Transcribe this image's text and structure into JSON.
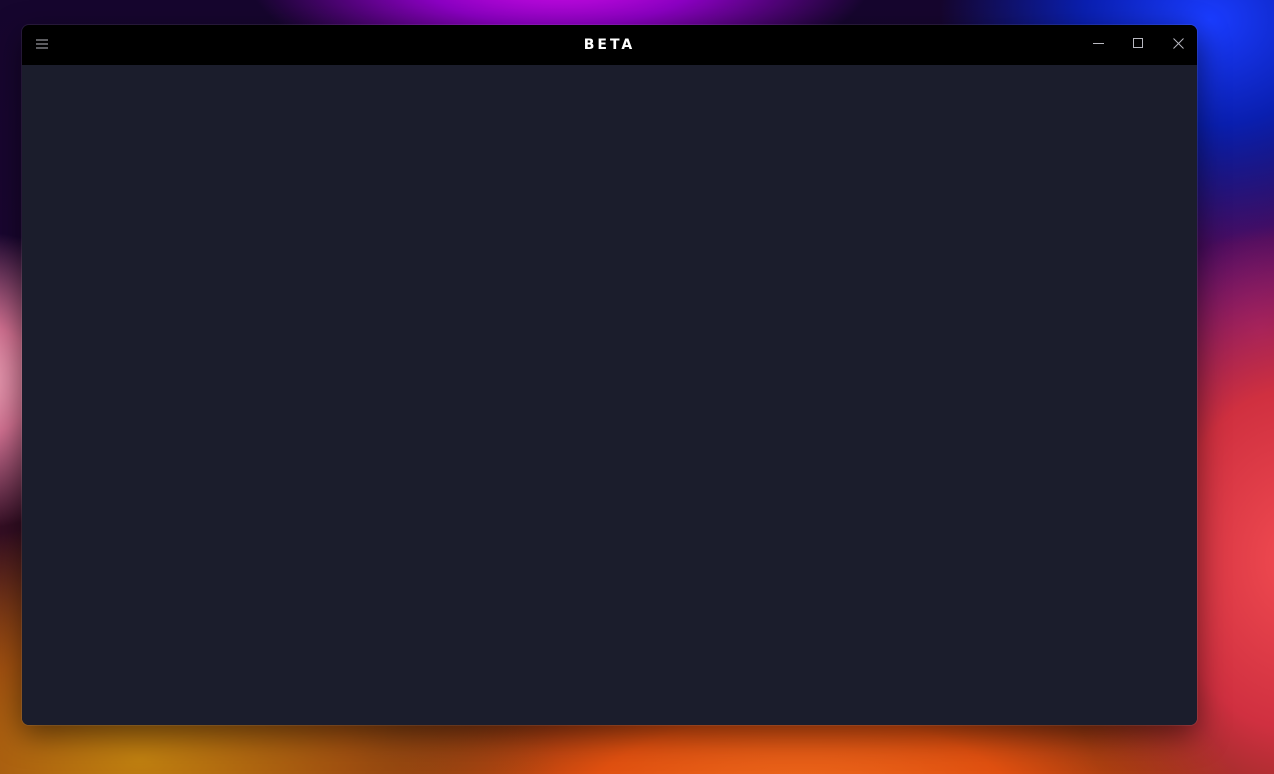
{
  "window": {
    "title": "BETA",
    "controls": {
      "menu_icon": "hamburger-icon",
      "minimize_icon": "minimize-icon",
      "maximize_icon": "maximize-icon",
      "close_icon": "close-icon"
    }
  },
  "colors": {
    "titlebar": "#000000",
    "content_background": "#1b1d2c",
    "title_text": "#ffffff",
    "icon": "#b8b8c0"
  }
}
